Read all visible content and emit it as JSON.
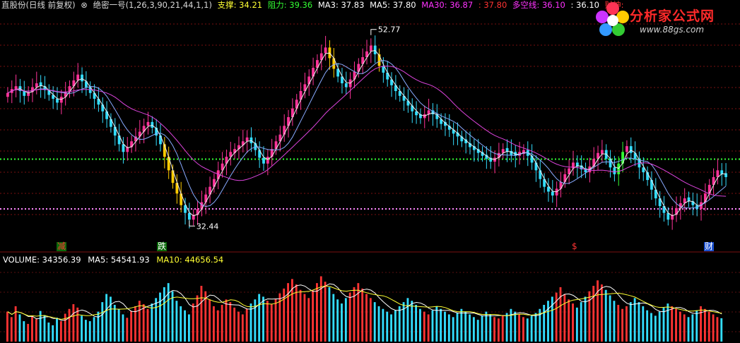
{
  "header": {
    "title": "直股份(日线 前复权)",
    "indicator_name": "绝密一号(1,26,3,90,21,44,1,1)",
    "support_label": "支撑: 34.21",
    "resistance_label": "阻力: 39.36",
    "ma3_label": "MA3: 37.83",
    "ma5_label": "MA5: 37.80",
    "ma30_label": "MA30: 36.87",
    "extra_value_1": ": 37.80",
    "duokong_label": "多空线: 36.10",
    "extra_value_2": ": 36.10",
    "caishen_label": "财神:",
    "colors": {
      "title": "#d8d8d8",
      "indicator": "#d8d8d8",
      "support": "#ffff33",
      "resistance": "#33ff33",
      "ma3": "#ffffff",
      "ma5": "#ffffff",
      "ma30": "#ff33ff",
      "extra1": "#ff3333",
      "duokong": "#ff33ff",
      "extra2": "#ffffff",
      "caishen": "#ff3333"
    }
  },
  "logo": {
    "title": "分析家公式网",
    "url": "www.88gs.com"
  },
  "volume_header": {
    "volume_label": "VOLUME: 34356.39",
    "ma5_label": "MA5: 54541.93",
    "ma10_label": "MA10: 44656.54"
  },
  "signals": [
    {
      "label": "减",
      "color": "#ff3333",
      "bg": "#0a6a0a"
    },
    {
      "label": "跌",
      "color": "#ffffff",
      "bg": "#0a6a0a"
    },
    {
      "label": "$",
      "color": "#ff3333",
      "bg": "#000000"
    },
    {
      "label": "财",
      "color": "#ffffff",
      "bg": "#1a4fcf"
    }
  ],
  "chart_data": [
    {
      "type": "candlestick",
      "name": "price",
      "ylim": [
        31.0,
        54.5
      ],
      "annotations": [
        {
          "label": "52.77",
          "value": 52.77,
          "kind": "high"
        },
        {
          "label": "32.44",
          "value": 32.44,
          "kind": "low"
        }
      ],
      "reference_lines": [
        {
          "value": 39.36,
          "color": "#33ff33",
          "style": "dotted"
        },
        {
          "value": 34.21,
          "color": "#ff88ff",
          "style": "dotted"
        }
      ],
      "colors": {
        "up": "#ff3399",
        "down": "#33ddff",
        "up_strong": "#ffcc00",
        "down_strong": "#33ff33",
        "ma_fast": "#eeeeee",
        "ma_mid": "#88aaff",
        "ma_slow": "#dd44dd"
      },
      "closes": [
        46.2,
        46.6,
        46.9,
        46.4,
        45.9,
        46.3,
        46.8,
        47.2,
        46.9,
        46.5,
        46.0,
        45.6,
        45.2,
        45.8,
        46.3,
        46.9,
        47.5,
        48.1,
        47.4,
        46.8,
        46.2,
        45.6,
        45.0,
        44.3,
        43.5,
        42.7,
        41.8,
        40.9,
        40.1,
        40.6,
        41.2,
        41.7,
        42.2,
        42.8,
        43.2,
        42.6,
        41.8,
        40.9,
        39.6,
        38.2,
        36.9,
        35.8,
        34.6,
        33.8,
        33.1,
        33.6,
        34.2,
        34.9,
        35.7,
        36.5,
        37.3,
        38.2,
        38.9,
        39.6,
        40.1,
        40.4,
        40.8,
        41.2,
        41.6,
        41.0,
        40.3,
        39.5,
        38.9,
        39.6,
        40.4,
        41.2,
        41.9,
        42.8,
        43.7,
        44.6,
        45.5,
        46.4,
        47.1,
        47.9,
        48.8,
        49.6,
        50.3,
        50.9,
        49.8,
        48.7,
        47.9,
        47.2,
        46.8,
        47.6,
        48.4,
        49.2,
        49.9,
        50.5,
        51.1,
        50.2,
        49.0,
        48.3,
        47.6,
        47.0,
        46.4,
        45.9,
        45.4,
        44.9,
        44.3,
        43.9,
        43.6,
        44.0,
        44.4,
        44.0,
        43.5,
        43.0,
        42.8,
        42.4,
        42.0,
        41.7,
        41.2,
        41.0,
        40.6,
        40.3,
        40.0,
        39.7,
        39.4,
        39.1,
        39.5,
        40.0,
        40.4,
        40.1,
        39.8,
        39.7,
        40.1,
        40.3,
        39.7,
        39.0,
        38.2,
        37.3,
        36.5,
        36.0,
        35.6,
        36.3,
        37.0,
        37.8,
        38.4,
        39.0,
        38.6,
        38.3,
        38.0,
        38.6,
        39.4,
        40.0,
        40.3,
        39.4,
        38.5,
        37.8,
        38.9,
        40.1,
        40.7,
        40.0,
        39.4,
        38.5,
        38.0,
        37.2,
        36.2,
        35.3,
        34.5,
        33.8,
        33.1,
        33.6,
        34.3,
        34.8,
        35.3,
        35.0,
        34.6,
        34.2,
        34.9,
        35.8,
        36.7,
        37.5,
        38.2,
        37.8,
        37.5
      ]
    },
    {
      "type": "bar",
      "name": "VOLUME",
      "ylim": [
        0,
        110000
      ],
      "colors": {
        "up": "#ff3333",
        "down": "#33ddff",
        "ma5": "#ffffff",
        "ma10": "#ffff33"
      },
      "values": [
        44000,
        36000,
        52000,
        40000,
        30000,
        26000,
        38000,
        33000,
        45000,
        39000,
        28000,
        24000,
        35000,
        30000,
        41000,
        48000,
        55000,
        50000,
        38000,
        32000,
        30000,
        36000,
        44000,
        58000,
        70000,
        66000,
        54000,
        48000,
        40000,
        35000,
        45000,
        52000,
        60000,
        55000,
        48000,
        56000,
        64000,
        72000,
        80000,
        86000,
        74000,
        60000,
        52000,
        46000,
        40000,
        56000,
        68000,
        82000,
        74000,
        62000,
        52000,
        46000,
        54000,
        62000,
        58000,
        50000,
        44000,
        40000,
        48000,
        56000,
        62000,
        70000,
        66000,
        60000,
        55000,
        63000,
        71000,
        78000,
        86000,
        92000,
        84000,
        76000,
        70000,
        64000,
        75000,
        86000,
        96000,
        88000,
        80000,
        70000,
        62000,
        56000,
        64000,
        72000,
        80000,
        86000,
        78000,
        70000,
        64000,
        58000,
        52000,
        48000,
        44000,
        40000,
        46000,
        52000,
        58000,
        64000,
        60000,
        54000,
        48000,
        44000,
        40000,
        46000,
        52000,
        48000,
        44000,
        40000,
        36000,
        42000,
        48000,
        44000,
        40000,
        36000,
        32000,
        38000,
        44000,
        40000,
        36000,
        34000,
        38000,
        42000,
        48000,
        44000,
        40000,
        36000,
        34000,
        38000,
        42000,
        48000,
        54000,
        60000,
        66000,
        72000,
        80000,
        70000,
        62000,
        56000,
        50000,
        58000,
        66000,
        74000,
        82000,
        90000,
        84000,
        76000,
        68000,
        60000,
        54000,
        48000,
        52000,
        58000,
        64000,
        58000,
        52000,
        46000,
        42000,
        38000,
        44000,
        50000,
        56000,
        52000,
        48000,
        44000,
        40000,
        36000,
        40000,
        46000,
        52000,
        48000,
        44000,
        40000,
        36000,
        34356
      ]
    }
  ]
}
